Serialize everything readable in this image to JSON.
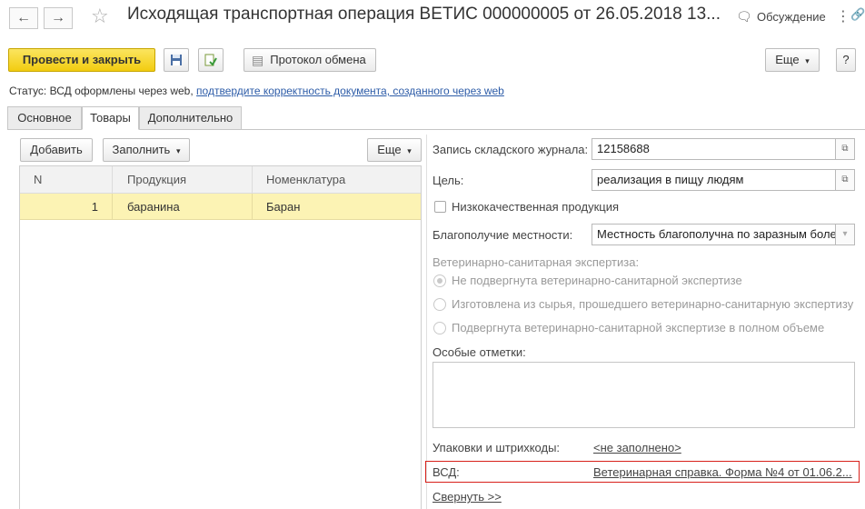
{
  "window": {
    "title": "Исходящая транспортная операция ВЕТИС 000000005 от 26.05.2018 13...",
    "discussion_label": "Обсуждение",
    "icons": [
      "arrow-left-icon",
      "arrow-right-icon",
      "star-icon",
      "discussion-icon",
      "more-vertical-icon",
      "link-icon",
      "maximize-icon",
      "close-icon"
    ]
  },
  "toolbar": {
    "post_close_label": "Провести и закрыть",
    "save_icon": "floppy-disk-icon",
    "post_icon": "document-post-icon",
    "exchange_log_label": "Протокол обмена",
    "more_label": "Еще",
    "help_label": "?"
  },
  "status": {
    "prefix": "Статус:",
    "text": "ВСД оформлены через web,",
    "link": "подтвердите корректность документа, созданного через web"
  },
  "tabs": [
    {
      "label": "Основное",
      "active": false
    },
    {
      "label": "Товары",
      "active": true
    },
    {
      "label": "Дополнительно",
      "active": false
    }
  ],
  "goods": {
    "add_label": "Добавить",
    "fill_label": "Заполнить",
    "more_label": "Еще",
    "columns": [
      "N",
      "Продукция",
      "Номенклатура"
    ],
    "rows": [
      {
        "n": "1",
        "product": "баранина",
        "nomenclature": "Баран"
      }
    ]
  },
  "details": {
    "journal_label": "Запись складского журнала:",
    "journal_value": "12158688",
    "purpose_label": "Цель:",
    "purpose_value": "реализация в пищу людям",
    "low_quality_label": "Низкокачественная продукция",
    "locality_label": "Благополучие местности:",
    "locality_value": "Местность благополучна по заразным боле",
    "vet_exam_label": "Ветеринарно-санитарная экспертиза:",
    "vet_exam_options": [
      {
        "label": "Не подвергнута ветеринарно-санитарной экспертизе",
        "selected": true
      },
      {
        "label": "Изготовлена из сырья, прошедшего ветеринарно-санитарную экспертизу",
        "selected": false
      },
      {
        "label": "Подвергнута ветеринарно-санитарной экспертизе в полном объеме",
        "selected": false
      }
    ],
    "special_marks_label": "Особые отметки:",
    "special_marks_value": "",
    "packages_label": "Упаковки и штрихкоды:",
    "packages_link": "<не заполнено>",
    "vsd_label": "ВСД:",
    "vsd_link": "Ветеринарная справка. Форма №4 от 01.06.2...",
    "collapse_link": "Свернуть >>"
  },
  "colors": {
    "primary_button": "#f2cc10",
    "selected_row": "#fcf3b4",
    "link": "#2d5ca8",
    "highlight_border": "#d8201a"
  }
}
